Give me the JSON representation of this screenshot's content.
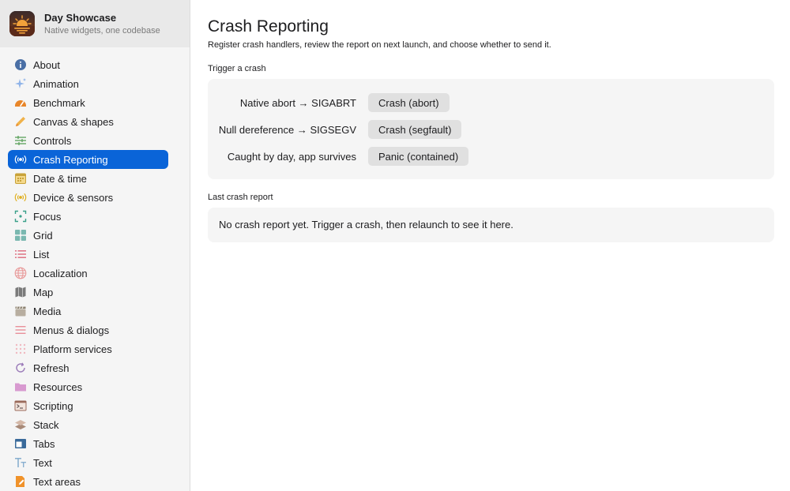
{
  "app": {
    "title": "Day Showcase",
    "subtitle": "Native widgets, one codebase"
  },
  "sidebar": {
    "active_index": 5,
    "accent_color": "#0a64d8",
    "items": [
      {
        "label": "About",
        "icon": "info-icon"
      },
      {
        "label": "Animation",
        "icon": "sparkles-icon"
      },
      {
        "label": "Benchmark",
        "icon": "speedometer-icon"
      },
      {
        "label": "Canvas & shapes",
        "icon": "pencil-icon"
      },
      {
        "label": "Controls",
        "icon": "sliders-icon"
      },
      {
        "label": "Crash Reporting",
        "icon": "broadcast-icon"
      },
      {
        "label": "Date & time",
        "icon": "calendar-icon"
      },
      {
        "label": "Device & sensors",
        "icon": "sensor-icon"
      },
      {
        "label": "Focus",
        "icon": "focus-icon"
      },
      {
        "label": "Grid",
        "icon": "grid-icon"
      },
      {
        "label": "List",
        "icon": "list-icon"
      },
      {
        "label": "Localization",
        "icon": "globe-icon"
      },
      {
        "label": "Map",
        "icon": "map-icon"
      },
      {
        "label": "Media",
        "icon": "clapperboard-icon"
      },
      {
        "label": "Menus & dialogs",
        "icon": "menu-icon"
      },
      {
        "label": "Platform services",
        "icon": "dots-grid-icon"
      },
      {
        "label": "Refresh",
        "icon": "refresh-icon"
      },
      {
        "label": "Resources",
        "icon": "folder-icon"
      },
      {
        "label": "Scripting",
        "icon": "terminal-icon"
      },
      {
        "label": "Stack",
        "icon": "layers-icon"
      },
      {
        "label": "Tabs",
        "icon": "tabs-icon"
      },
      {
        "label": "Text",
        "icon": "text-icon"
      },
      {
        "label": "Text areas",
        "icon": "document-edit-icon"
      }
    ]
  },
  "main": {
    "title": "Crash Reporting",
    "description": "Register crash handlers, review the report on next launch, and choose whether to send it.",
    "trigger_section": {
      "label": "Trigger a crash",
      "rows": [
        {
          "label": "Native abort → SIGABRT",
          "button": "Crash (abort)"
        },
        {
          "label": "Null dereference → SIGSEGV",
          "button": "Crash (segfault)"
        },
        {
          "label": "Caught by day, app survives",
          "button": "Panic (contained)"
        }
      ]
    },
    "report_section": {
      "label": "Last crash report",
      "text": "No crash report yet. Trigger a crash, then relaunch to see it here."
    }
  }
}
